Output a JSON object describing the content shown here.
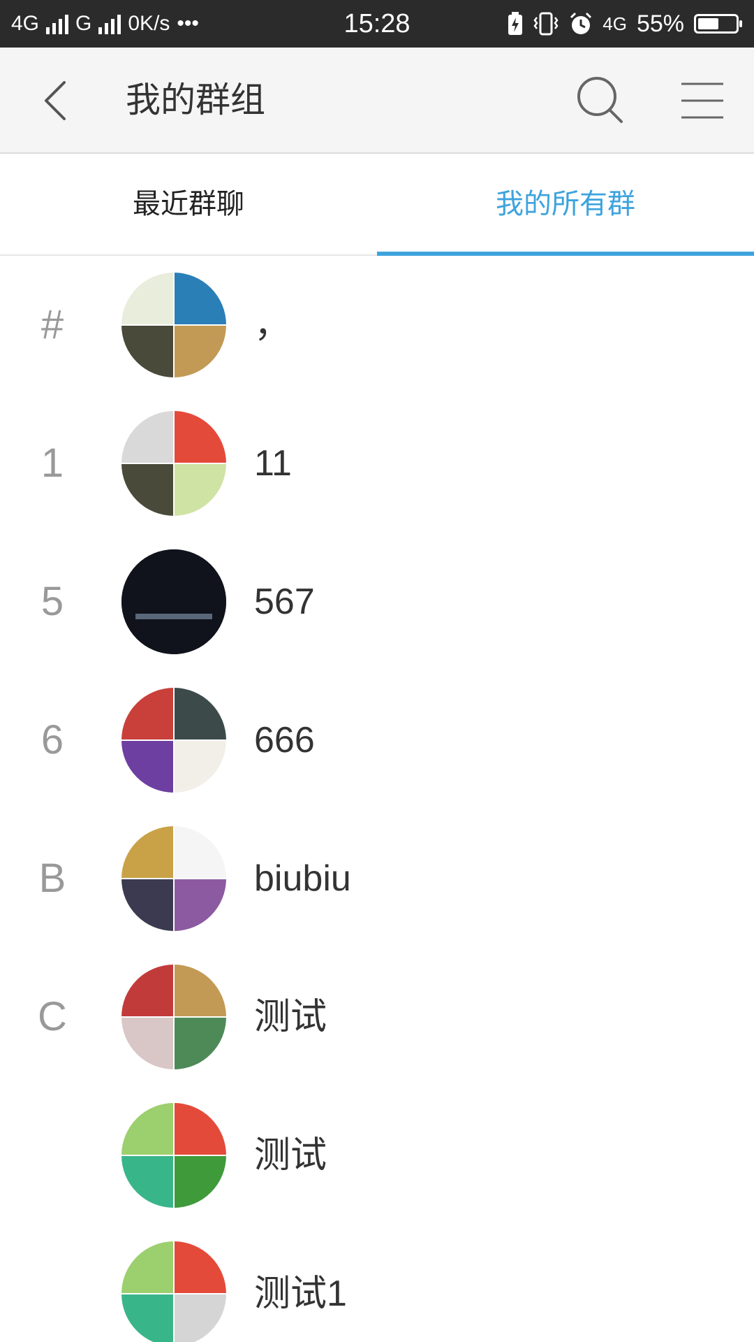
{
  "status_bar": {
    "network1": "4G",
    "network2": "G",
    "speed": "0K/s",
    "dots": "•••",
    "time": "15:28",
    "network3": "4G",
    "battery_text": "55%",
    "battery_level": 0.55
  },
  "header": {
    "title": "我的群组",
    "back_icon": "chevron-left",
    "search_icon": "magnifier",
    "menu_icon": "hamburger"
  },
  "tabs": [
    {
      "label": "最近群聊",
      "active": false
    },
    {
      "label": "我的所有群",
      "active": true
    }
  ],
  "accent_color": "#3ea3dd",
  "groups": [
    {
      "index_letter": "#",
      "name": "，",
      "avatar_colors": [
        "#e8eddc",
        "#2a7fb6",
        "#4a4a3a",
        "#c29a55"
      ]
    },
    {
      "index_letter": "1",
      "name": "11",
      "avatar_colors": [
        "#d9d9d9",
        "#e44a3a",
        "#4a4a3a",
        "#cfe3a4"
      ]
    },
    {
      "index_letter": "5",
      "name": "567",
      "avatar_colors": [
        "#10131c",
        "#10131c",
        "#10131c",
        "#10131c"
      ]
    },
    {
      "index_letter": "6",
      "name": "666",
      "avatar_colors": [
        "#c9403a",
        "#3c4a4a",
        "#6d3fa0",
        "#f1efe8"
      ]
    },
    {
      "index_letter": "B",
      "name": "biubiu",
      "avatar_colors": [
        "#c9a247",
        "#f5f5f5",
        "#3b3a50",
        "#8c5aa0"
      ]
    },
    {
      "index_letter": "C",
      "name": "测试",
      "avatar_colors": [
        "#c23b3b",
        "#c29a55",
        "#d9c7c7",
        "#4d8a58"
      ]
    },
    {
      "index_letter": "",
      "name": "测试",
      "avatar_colors": [
        "#9ccf6d",
        "#e44a3a",
        "#39b58a",
        "#3f9a3a"
      ]
    },
    {
      "index_letter": "",
      "name": "测试1",
      "avatar_colors": [
        "#9ccf6d",
        "#e44a3a",
        "#39b58a",
        "#d5d5d5"
      ]
    }
  ]
}
